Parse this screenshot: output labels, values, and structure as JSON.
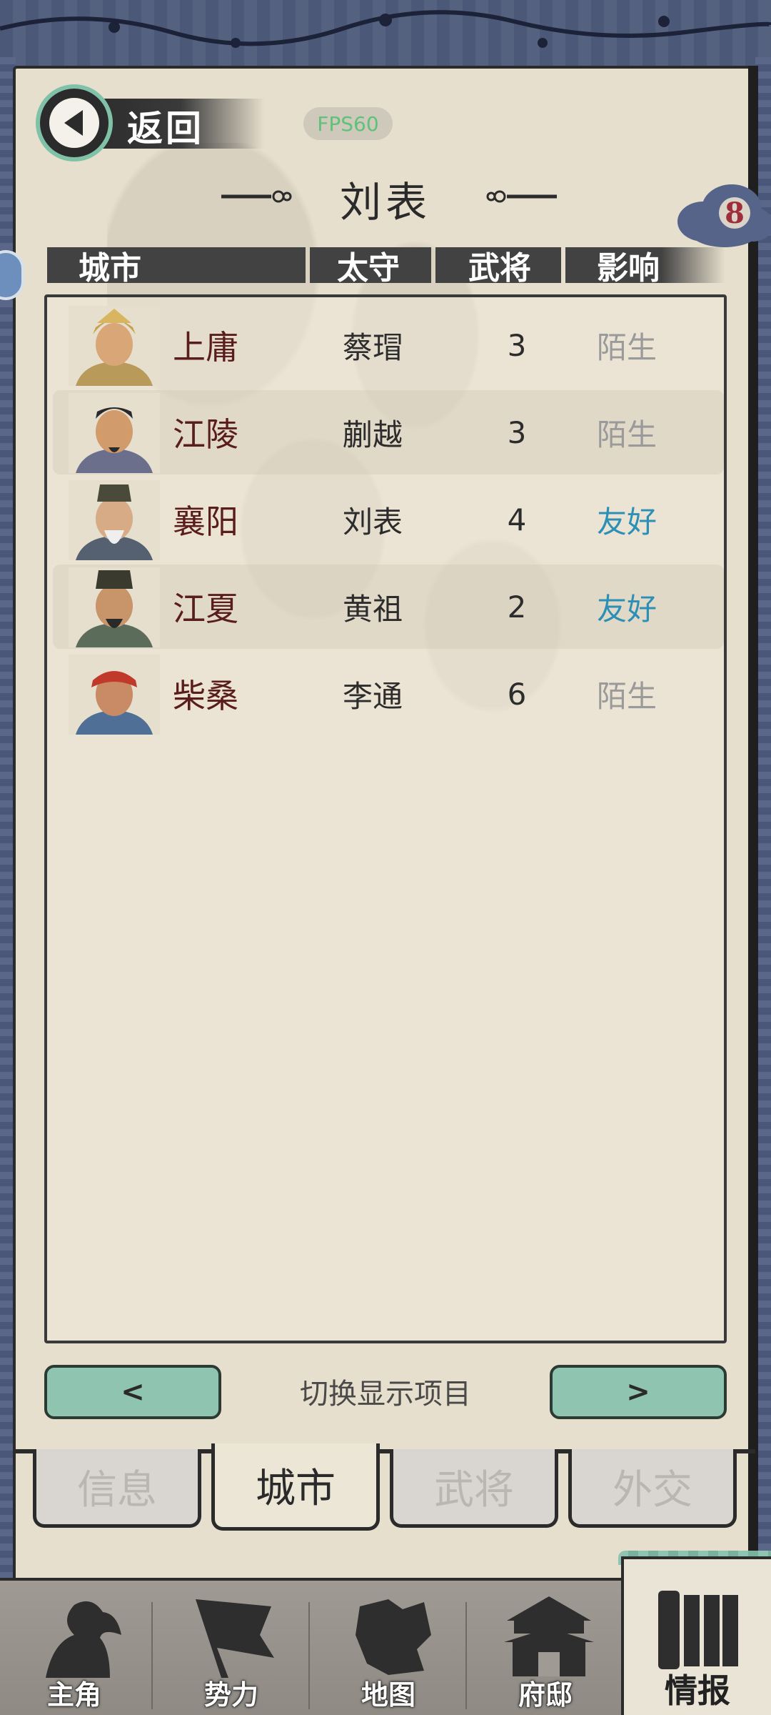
{
  "header": {
    "back_label": "返回",
    "fps": "FPS60",
    "faction_title": "刘表",
    "badge_count": "8"
  },
  "table": {
    "columns": [
      "城市",
      "太守",
      "武将",
      "影响"
    ],
    "rows": [
      {
        "city": "上庸",
        "governor": "蔡瑁",
        "generals": "3",
        "influence": "陌生",
        "influence_color": "#9a9a9a"
      },
      {
        "city": "江陵",
        "governor": "蒯越",
        "generals": "3",
        "influence": "陌生",
        "influence_color": "#9a9a9a"
      },
      {
        "city": "襄阳",
        "governor": "刘表",
        "generals": "4",
        "influence": "友好",
        "influence_color": "#2b8fb6"
      },
      {
        "city": "江夏",
        "governor": "黄祖",
        "generals": "2",
        "influence": "友好",
        "influence_color": "#2b8fb6"
      },
      {
        "city": "柴桑",
        "governor": "李通",
        "generals": "6",
        "influence": "陌生",
        "influence_color": "#9a9a9a"
      }
    ]
  },
  "switcher": {
    "prev_label": "<",
    "next_label": ">",
    "label": "切换显示项目"
  },
  "subtabs": {
    "info": "信息",
    "city": "城市",
    "generals": "武将",
    "diplomacy": "外交",
    "active": "城市"
  },
  "bottom_nav": {
    "hero": "主角",
    "faction": "势力",
    "map": "地图",
    "mansion": "府邸",
    "intel": "情报",
    "active": "情报"
  }
}
